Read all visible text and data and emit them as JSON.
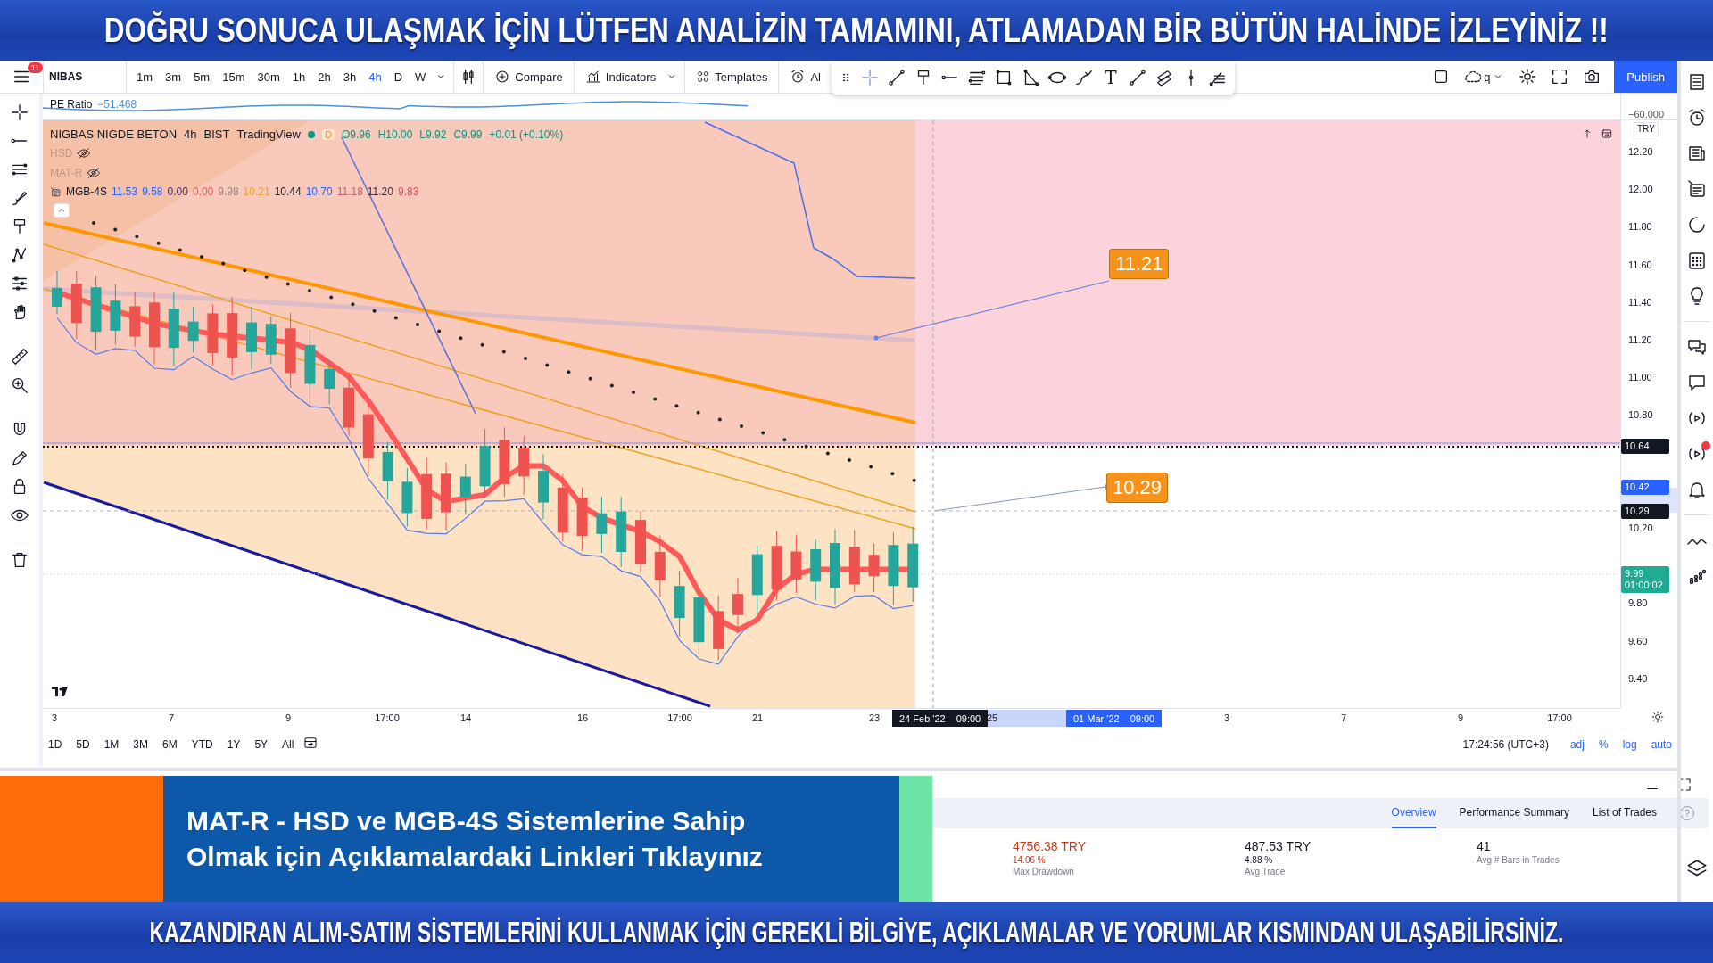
{
  "top_banner": {
    "text": "DOĞRU SONUCA ULAŞMAK İÇİN LÜTFEN ANALİZİN TAMAMINI, ATLAMADAN BİR BÜTÜN HALİNDE İZLEYİNİZ !!"
  },
  "toolbar": {
    "menu_badge": "11",
    "symbol": "NIBAS",
    "intervals": [
      {
        "label": "1m",
        "selected": false
      },
      {
        "label": "3m",
        "selected": false
      },
      {
        "label": "5m",
        "selected": false
      },
      {
        "label": "15m",
        "selected": false
      },
      {
        "label": "30m",
        "selected": false
      },
      {
        "label": "1h",
        "selected": false
      },
      {
        "label": "2h",
        "selected": false
      },
      {
        "label": "3h",
        "selected": false
      },
      {
        "label": "4h",
        "selected": true
      },
      {
        "label": "D",
        "selected": false
      },
      {
        "label": "W",
        "selected": false
      }
    ],
    "compare": "Compare",
    "indicators": "Indicators",
    "templates": "Templates",
    "alert": "Al",
    "text_tool": "T",
    "layout_name": "q",
    "publish": "Publish"
  },
  "pe_pane": {
    "label": "PE Ratio",
    "value": "−51.468",
    "axis_label": "−60.000"
  },
  "legend": {
    "symbol": "NIGBAS NIGDE BETON",
    "interval": "4h",
    "exchange": "BIST",
    "source": "TradingView",
    "flag": "D",
    "ohlc": [
      "O9.96",
      "H10.00",
      "L9.92",
      "C9.99",
      "+0.01 (+0.10%)"
    ],
    "indicators": [
      {
        "name": "HSD",
        "visible": false
      },
      {
        "name": "MAT-R",
        "visible": false
      },
      {
        "name": "MGB-4S",
        "visible": true,
        "values": [
          {
            "text": "11.53",
            "color": "#2962ff"
          },
          {
            "text": "9.58",
            "color": "#2962ff"
          },
          {
            "text": "0.00",
            "color": "#4a2c7a"
          },
          {
            "text": "0.00",
            "color": "#f05a5a"
          },
          {
            "text": "9.98",
            "color": "#9a8a80"
          },
          {
            "text": "10.21",
            "color": "#f0a030"
          },
          {
            "text": "10.44",
            "color": "#222222"
          },
          {
            "text": "10.70",
            "color": "#2962ff"
          },
          {
            "text": "11.18",
            "color": "#c06070"
          },
          {
            "text": "11.20",
            "color": "#3a2a40"
          },
          {
            "text": "9.83",
            "color": "#e0506a"
          }
        ]
      }
    ]
  },
  "chart_labels": [
    {
      "text": "11.21"
    },
    {
      "text": "10.29"
    }
  ],
  "price_axis": {
    "currency": "TRY",
    "ticks": [
      "12.20",
      "12.00",
      "11.80",
      "11.60",
      "11.40",
      "11.20",
      "11.00",
      "10.80",
      "10.20",
      "9.80",
      "9.60",
      "9.40"
    ]
  },
  "price_badges": [
    {
      "text": "10.64",
      "color": "#131722"
    },
    {
      "text": "10.42",
      "color": "#2962ff"
    },
    {
      "text": "10.29",
      "color": "#131722"
    },
    {
      "text": "9.99",
      "sub": "01:00:02",
      "color": "#22ab94"
    }
  ],
  "time_axis": {
    "ticks": [
      {
        "label": "3",
        "kind": "tick"
      },
      {
        "label": "7",
        "kind": "tick"
      },
      {
        "label": "9",
        "kind": "tick"
      },
      {
        "label": "17:00",
        "kind": "tick"
      },
      {
        "label": "14",
        "kind": "tick"
      },
      {
        "label": "16",
        "kind": "tick"
      },
      {
        "label": "17:00",
        "kind": "tick"
      },
      {
        "label": "21",
        "kind": "tick"
      },
      {
        "label": "23",
        "kind": "tick"
      },
      {
        "label": "24 Feb '22",
        "time": "09:00",
        "kind": "crosshair"
      },
      {
        "label": "25",
        "kind": "tick"
      },
      {
        "label": "01 Mar '22",
        "time": "09:00",
        "kind": "range"
      },
      {
        "label": "3",
        "kind": "tick"
      },
      {
        "label": "7",
        "kind": "tick"
      },
      {
        "label": "9",
        "kind": "tick"
      },
      {
        "label": "17:00",
        "kind": "tick"
      }
    ]
  },
  "range_bar": {
    "ranges": [
      "1D",
      "5D",
      "1M",
      "3M",
      "6M",
      "YTD",
      "1Y",
      "5Y",
      "All"
    ],
    "clock": "17:24:56 (UTC+3)",
    "options": [
      "adj",
      "%",
      "log",
      "auto"
    ]
  },
  "promo": {
    "lines": [
      "MAT-R - HSD ve MGB-4S Sistemlerine Sahip",
      "Olmak için Açıklamalardaki Linkleri Tıklayınız"
    ]
  },
  "strategy": {
    "tabs": [
      {
        "label": "Overview",
        "selected": true
      },
      {
        "label": "Performance Summary",
        "selected": false
      },
      {
        "label": "List of Trades",
        "selected": false
      }
    ],
    "help": "?",
    "stats": [
      {
        "value": "4756.38 TRY",
        "percent": "14.06 %",
        "label": "Max Drawdown",
        "color": "#c8391b"
      },
      {
        "value": "487.53 TRY",
        "percent": "4.88 %",
        "label": "Avg Trade",
        "color": "#131722"
      },
      {
        "value": "41",
        "label": "Avg # Bars in Trades",
        "color": "#131722"
      }
    ]
  },
  "bottom_banner": {
    "text": "KAZANDIRAN ALIM-SATIM SİSTEMLERİNİ KULLANMAK İÇİN GEREKLİ  BİLGİYE, AÇIKLAMALAR VE YORUMLAR KISMINDAN ULAŞABİLİRSİNİZ."
  }
}
